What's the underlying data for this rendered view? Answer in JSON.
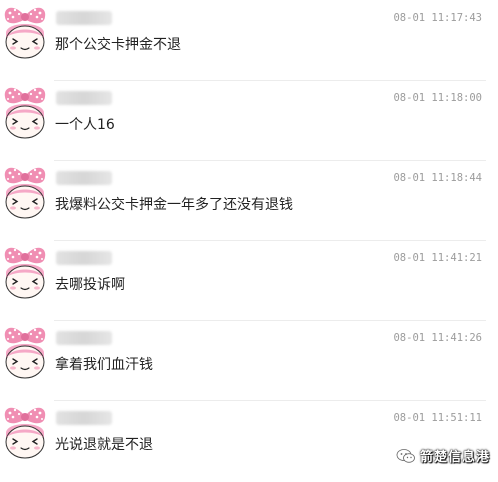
{
  "comments": [
    {
      "time": "08-01 11:17:43",
      "text": "那个公交卡押金不退"
    },
    {
      "time": "08-01 11:18:00",
      "text": "一个人16"
    },
    {
      "time": "08-01 11:18:44",
      "text": "我爆料公交卡押金一年多了还没有退钱"
    },
    {
      "time": "08-01 11:41:21",
      "text": "去哪投诉啊"
    },
    {
      "time": "08-01 11:41:26",
      "text": "拿着我们血汗钱"
    },
    {
      "time": "08-01 11:51:11",
      "text": "光说退就是不退"
    }
  ],
  "avatar_icon": "pink-bow-cartoon-girl-icon",
  "watermark": {
    "text": "箭楚信息港",
    "icon": "wechat-icon"
  }
}
